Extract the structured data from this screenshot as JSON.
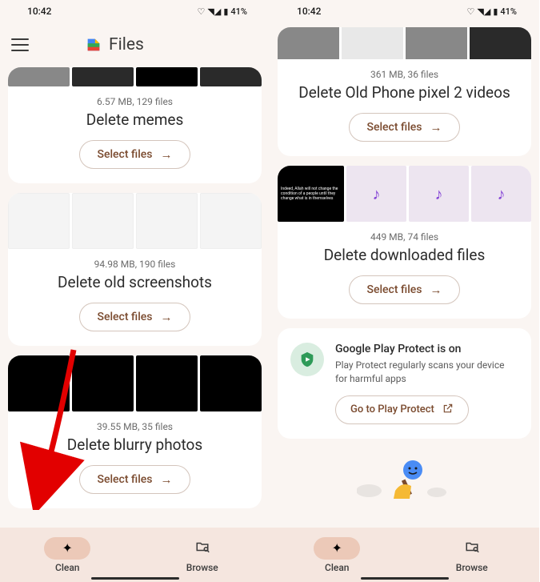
{
  "status": {
    "time": "10:42",
    "battery": "41%",
    "indicators": "▤ ▲ ✆ ☾ •",
    "signal": "◥◢"
  },
  "app": {
    "title": "Files"
  },
  "left": {
    "cards": [
      {
        "stats": "6.57 MB, 129 files",
        "title": "Delete memes",
        "btn": "Select files"
      },
      {
        "stats": "94.98 MB, 190 files",
        "title": "Delete old screenshots",
        "btn": "Select files"
      },
      {
        "stats": "39.55 MB, 35 files",
        "title": "Delete blurry photos",
        "btn": "Select files"
      }
    ]
  },
  "right": {
    "cards": [
      {
        "stats": "361 MB, 36 files",
        "title": "Delete Old Phone pixel 2 videos",
        "btn": "Select files"
      },
      {
        "stats": "449 MB, 74 files",
        "title": "Delete downloaded files",
        "btn": "Select files"
      }
    ],
    "protect": {
      "title": "Google Play Protect is on",
      "desc": "Play Protect regularly scans your device for harmful apps",
      "btn": "Go to Play Protect"
    }
  },
  "nav": {
    "clean": "Clean",
    "browse": "Browse"
  }
}
